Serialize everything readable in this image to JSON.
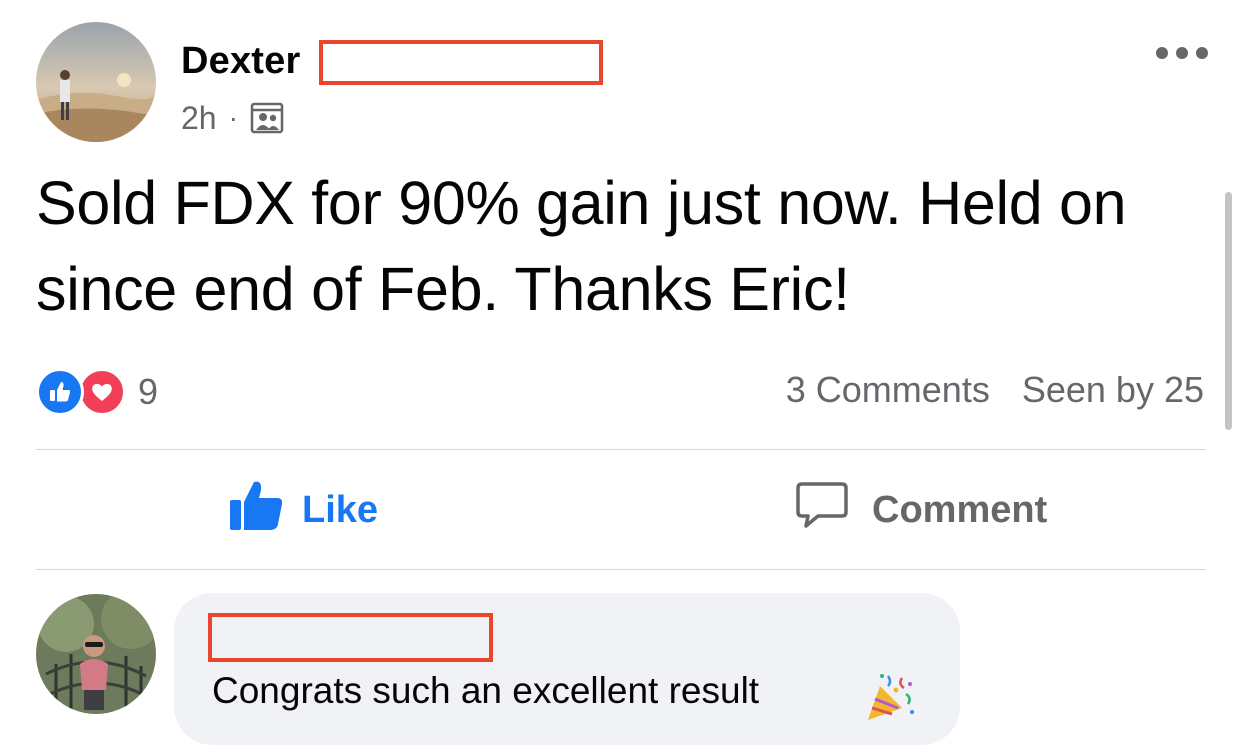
{
  "post": {
    "author_name": "Dexter",
    "time_ago": "2h",
    "separator": "·",
    "audience_icon": "group-audience-icon",
    "more_icon": "more-horizontal-icon",
    "text": "Sold FDX for 90% gain just now. Held on since end of Feb. Thanks Eric!"
  },
  "reactions": {
    "types": [
      "like-icon",
      "love-icon"
    ],
    "count": "9",
    "comments_label": "3 Comments",
    "seen_label": "Seen by 25"
  },
  "actions": {
    "like_label": "Like",
    "comment_label": "Comment"
  },
  "comment": {
    "text": "Congrats such an excellent result",
    "emoji_icon": "party-popper-icon"
  },
  "colors": {
    "brand_blue": "#1877f2",
    "love_red": "#f33e58",
    "redaction": "#e8472e",
    "secondary_text": "#65676b",
    "bubble_bg": "#f0f2f5"
  }
}
